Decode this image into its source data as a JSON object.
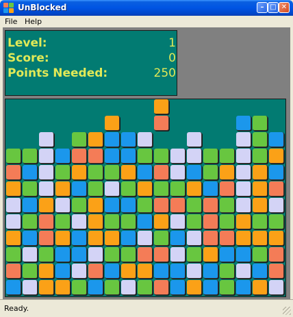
{
  "window": {
    "title": "UnBlocked"
  },
  "menu": {
    "items": [
      "File",
      "Help"
    ]
  },
  "score": {
    "level_label": "Level:",
    "level_value": "1",
    "score_label": "Score:",
    "score_value": "0",
    "needed_label": "Points Needed:",
    "needed_value": "250"
  },
  "status": {
    "text": "Ready."
  },
  "colors": {
    "board_bg": "#027b72",
    "O": "#fba117",
    "G": "#68c640",
    "B": "#1b97ec",
    "R": "#f47c57",
    "L": "#d3d3f6"
  },
  "board": {
    "columns": 17,
    "rows": 12,
    "grid_top_to_bottom": [
      ".........O.......",
      "......O..R....BG.",
      "..L.GOBBL..L..LGB",
      "GGLBRRBBGGLLGGLGO",
      "RBLGOGGOBRLBGOLOB",
      "OGLOBGLGOGGOBRLOR",
      "LBOLGOBBGRRGRGLOL",
      "LGRGLOGGBOLGRGOGG",
      "OBROBOOBLGBLRROOO",
      "GLGBBLGGRRLGOBBGR",
      "RGOBLRBOOBBLBGLBR",
      "BLOOGBGLGRBOBGBOL"
    ]
  }
}
